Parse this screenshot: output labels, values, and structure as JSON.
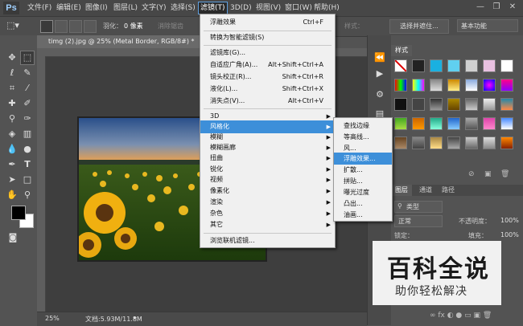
{
  "app": {
    "logo": "Ps"
  },
  "menubar": {
    "items": [
      "文件(F)",
      "编辑(E)",
      "图像(I)",
      "图层(L)",
      "文字(Y)",
      "选择(S)",
      "滤镜(T)",
      "3D(D)",
      "视图(V)",
      "窗口(W)",
      "帮助(H)"
    ],
    "active": "滤镜(T)",
    "window_buttons": {
      "minimize": "—",
      "restore": "❐",
      "close": "✕"
    }
  },
  "options_bar": {
    "feather_label": "羽化：",
    "feather_value": "0 像素",
    "antialias_label": "消除锯齿",
    "style_label": "样式：",
    "mask_button": "选择并遮住...",
    "workspace": "基本功能"
  },
  "document": {
    "tab_title": "timg (2).jpg @ 25% (Metal Border, RGB/8#) *",
    "tab_close": "×",
    "zoom": "25%",
    "doc_info": "文档:5.93M/11.8M"
  },
  "filter_menu": {
    "items": [
      {
        "label": "浮雕效果",
        "shortcut": "Ctrl+F"
      },
      {
        "label": "转换为智能滤镜(S)",
        "shortcut": ""
      },
      {
        "label": "滤镜库(G)...",
        "shortcut": ""
      },
      {
        "label": "自适应广角(A)...",
        "shortcut": "Alt+Shift+Ctrl+A"
      },
      {
        "label": "镜头校正(R)...",
        "shortcut": "Shift+Ctrl+R"
      },
      {
        "label": "液化(L)...",
        "shortcut": "Shift+Ctrl+X"
      },
      {
        "label": "消失点(V)...",
        "shortcut": "Alt+Ctrl+V"
      },
      {
        "label": "3D",
        "shortcut": ""
      },
      {
        "label": "风格化",
        "shortcut": ""
      },
      {
        "label": "模糊",
        "shortcut": ""
      },
      {
        "label": "模糊画廊",
        "shortcut": ""
      },
      {
        "label": "扭曲",
        "shortcut": ""
      },
      {
        "label": "锐化",
        "shortcut": ""
      },
      {
        "label": "视频",
        "shortcut": ""
      },
      {
        "label": "像素化",
        "shortcut": ""
      },
      {
        "label": "渲染",
        "shortcut": ""
      },
      {
        "label": "杂色",
        "shortcut": ""
      },
      {
        "label": "其它",
        "shortcut": ""
      },
      {
        "label": "浏览联机滤镜...",
        "shortcut": ""
      }
    ],
    "highlighted": "风格化"
  },
  "stylize_submenu": {
    "items": [
      "查找边缘",
      "等高线...",
      "风...",
      "浮雕效果...",
      "扩散...",
      "拼贴...",
      "曝光过度",
      "凸出...",
      "油画..."
    ],
    "highlighted": "浮雕效果..."
  },
  "swatches_panel": {
    "tab": "样式"
  },
  "layers_panel": {
    "tabs": [
      "图层",
      "通道",
      "路径"
    ],
    "filter_kind": "类型",
    "blend_mode": "正常",
    "opacity_label": "不透明度：",
    "opacity_value": "100%",
    "lock_label": "锁定：",
    "fill_label": "填充：",
    "fill_value": "100%"
  },
  "watermark": {
    "line1": "百科全说",
    "line2": "助你轻松解决"
  },
  "colors": {
    "highlight": "#3d8fd9",
    "menu_bg": "#f0f0f0"
  }
}
